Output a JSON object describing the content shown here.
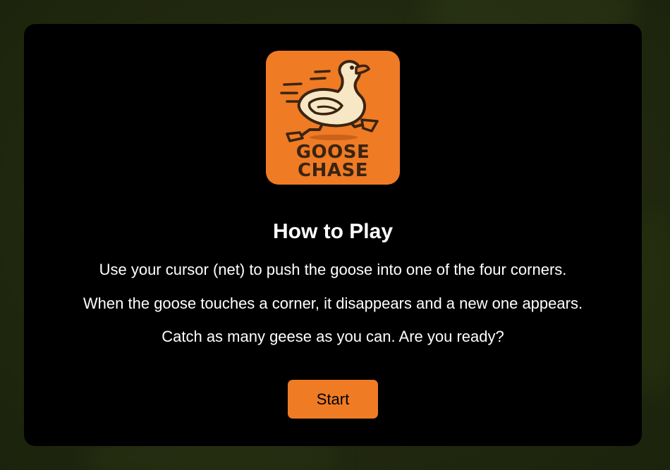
{
  "colors": {
    "backdrop": "#222a10",
    "modal_bg": "#000000",
    "accent_orange": "#ef7b25",
    "goose_body": "#f8e7c4",
    "outline": "#3a2410",
    "text": "#ffffff",
    "button_text": "#000000"
  },
  "logo": {
    "icon": "running-goose-icon",
    "line1": "GOOSE",
    "line2": "CHASE"
  },
  "instructions": {
    "title": "How to Play",
    "lines": [
      "Use your cursor (net) to push the goose into one of the four corners.",
      "When the goose touches a corner, it disappears and a new one appears.",
      "Catch as many geese as you can. Are you ready?"
    ]
  },
  "start_button": {
    "label": "Start"
  }
}
